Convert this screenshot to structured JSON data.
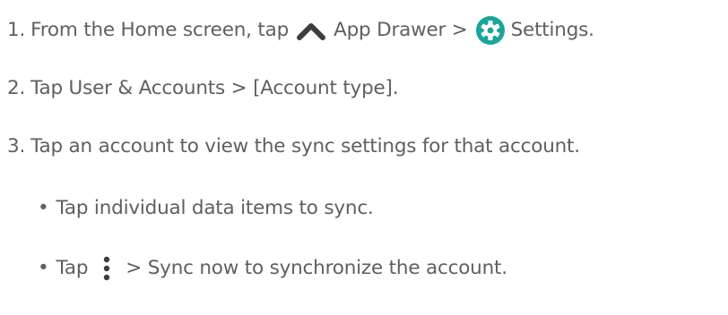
{
  "steps": [
    {
      "number": "1.",
      "part_a": "From the Home screen, tap",
      "icon_a": "chevron-up-icon",
      "part_b": "App Drawer >",
      "icon_b": "settings-gear-icon",
      "part_c": "Settings."
    },
    {
      "number": "2.",
      "text": "Tap User & Accounts > [Account type]."
    },
    {
      "number": "3.",
      "text": "Tap an account to view the sync settings for that account."
    }
  ],
  "bullets": [
    {
      "marker": "•",
      "text": "Tap individual data items to sync."
    },
    {
      "marker": "•",
      "part_a": "Tap",
      "icon": "more-vertical-icon",
      "part_b": "> Sync now to synchronize the account."
    }
  ],
  "colors": {
    "text": "#5f5f5f",
    "icon_dark": "#3d3d3d",
    "settings_teal": "#1aa59a"
  }
}
